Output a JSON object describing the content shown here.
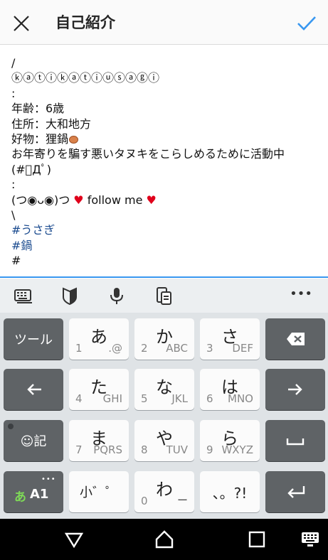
{
  "header": {
    "title": "自己紹介",
    "close_icon": "close-icon",
    "confirm_icon": "check-icon",
    "accent": "#3897f0"
  },
  "bio": {
    "lines": [
      "/",
      "ⓚⓐⓣⓘⓚⓐⓣⓘⓤⓢⓐⓖⓘ",
      ":",
      "年齢：6歳",
      "住所：大和地方",
      "好物：狸鍋",
      "お年寄りを騙す悪いタヌキをこらしめるために活動中",
      "(#ﾟДﾟ)",
      ":",
      "(つ◉ᴗ◉)つ",
      "follow me",
      "\\",
      "#うさぎ",
      "#鍋",
      "#"
    ]
  },
  "ime_toolbar": {
    "icons": [
      "keyboard-icon",
      "shield-icon",
      "microphone-icon",
      "clipboard-icon",
      "more-icon"
    ],
    "more_label": "•••"
  },
  "keyboard": {
    "tool_label": "ツール",
    "emoji_label": "☺記",
    "mode_kana": "あ",
    "mode_alnum": "A1",
    "keys": [
      {
        "main": "あ",
        "num": "1",
        "alt": ".@"
      },
      {
        "main": "か",
        "num": "2",
        "alt": "ABC"
      },
      {
        "main": "さ",
        "num": "3",
        "alt": "DEF"
      },
      {
        "main": "た",
        "num": "4",
        "alt": "GHI"
      },
      {
        "main": "な",
        "num": "5",
        "alt": "JKL"
      },
      {
        "main": "は",
        "num": "6",
        "alt": "MNO"
      },
      {
        "main": "ま",
        "num": "7",
        "alt": "PQRS"
      },
      {
        "main": "や",
        "num": "8",
        "alt": "TUV"
      },
      {
        "main": "ら",
        "num": "9",
        "alt": "WXYZ"
      },
      {
        "main": "小゛゜",
        "num": "",
        "alt": ""
      },
      {
        "main": "わ",
        "num": "0",
        "alt": "ー"
      },
      {
        "main": "、。?!",
        "num": "",
        "alt": ""
      }
    ]
  },
  "navbar": {
    "icons": [
      "back-icon",
      "home-icon",
      "recents-icon",
      "keyboard-switch-icon"
    ]
  }
}
